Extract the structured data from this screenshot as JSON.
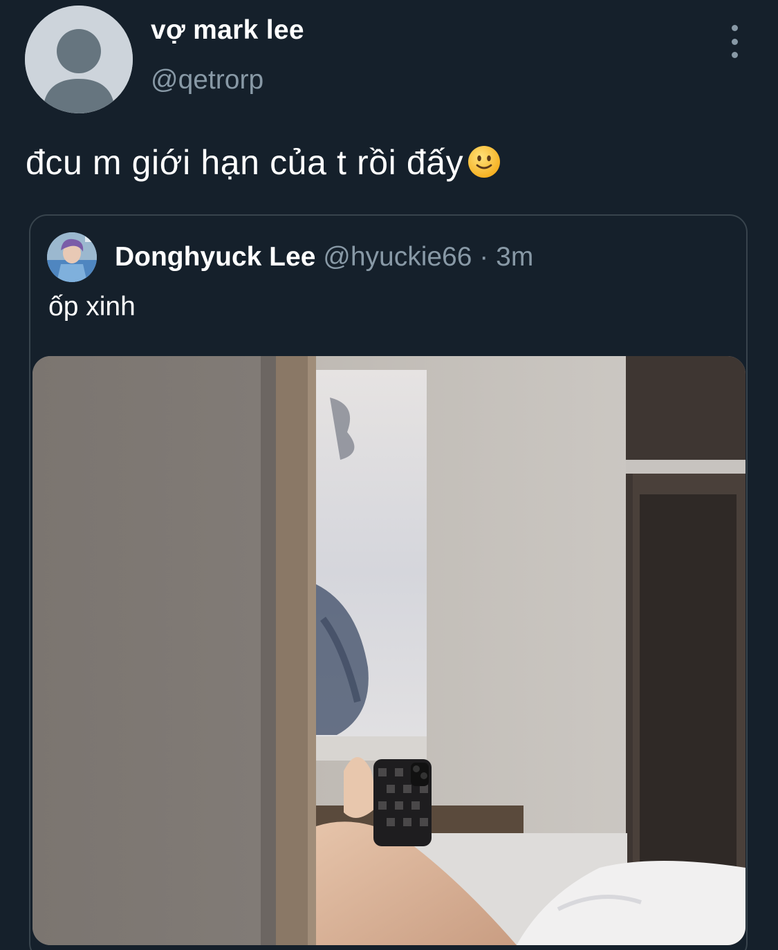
{
  "tweet": {
    "display_name": "vợ mark lee",
    "handle": "@qetrorp",
    "text": "đcu m giới hạn của t rồi đấy",
    "emoji": "slightly-smiling-face-emoji",
    "more_icon": "more-vertical-icon"
  },
  "quote": {
    "display_name": "Donghyuck Lee",
    "handle": "@hyuckie66",
    "separator": "·",
    "time": "3m",
    "text": "ốp xinh",
    "media": "mirror-selfie-photo"
  },
  "colors": {
    "background": "#15202b",
    "primary_text": "#ffffff",
    "secondary_text": "#8899a6",
    "border": "#38444d"
  }
}
